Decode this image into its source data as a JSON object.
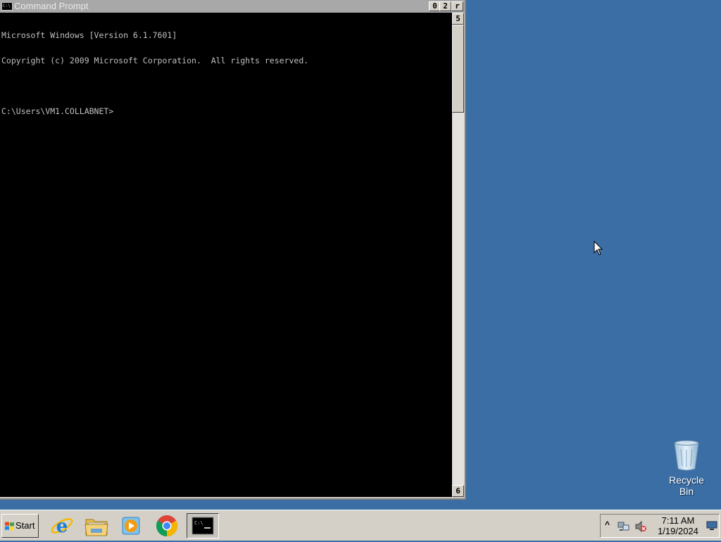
{
  "window": {
    "title": "Command Prompt",
    "controls": {
      "minimize": "0",
      "maximize": "2",
      "close": "r"
    },
    "scroll": {
      "up": "5",
      "down": "6"
    }
  },
  "console": {
    "lines": [
      "Microsoft Windows [Version 6.1.7601]",
      "Copyright (c) 2009 Microsoft Corporation.  All rights reserved.",
      "",
      "C:\\Users\\VM1.COLLABNET>"
    ]
  },
  "desktop": {
    "background_color": "#3a6ea5",
    "icons": [
      {
        "label": "Recycle Bin",
        "icon": "recycle-bin-icon"
      }
    ]
  },
  "taskbar": {
    "start_label": "Start",
    "pinned": [
      {
        "name": "Internet Explorer",
        "icon": "internet-explorer-icon"
      },
      {
        "name": "Windows Explorer",
        "icon": "file-explorer-icon"
      },
      {
        "name": "Windows Media Player",
        "icon": "media-player-icon"
      },
      {
        "name": "Google Chrome",
        "icon": "chrome-icon"
      },
      {
        "name": "Command Prompt",
        "icon": "command-prompt-icon",
        "active": true
      }
    ],
    "tray": {
      "time": "7:11 AM",
      "date": "1/19/2024",
      "chevron": "^"
    }
  }
}
